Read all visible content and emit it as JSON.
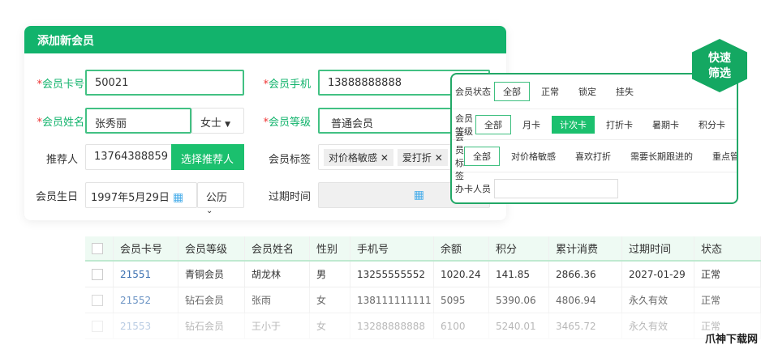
{
  "form": {
    "title": "添加新会员",
    "card_label": "会员卡号",
    "card_value": "50021",
    "phone_label": "会员手机",
    "phone_value": "13888888888",
    "name_label": "会员姓名",
    "name_value": "张秀丽",
    "gender_value": "女士",
    "level_label": "会员等级",
    "level_value": "普通会员",
    "referrer_label": "推荐人",
    "referrer_value": "13764388859",
    "referrer_button": "选择推荐人",
    "tags_label": "会员标签",
    "tags": [
      "对价格敏感",
      "爱打折"
    ],
    "birthday_label": "会员生日",
    "birthday_value": "1997年5月29日",
    "calendar_value": "公历",
    "expire_label": "过期时间"
  },
  "filter": {
    "badge_line1": "快速",
    "badge_line2": "筛选",
    "rows": [
      {
        "label": "会员状态",
        "options": [
          "全部",
          "正常",
          "锁定",
          "挂失"
        ]
      },
      {
        "label": "会员等级",
        "options": [
          "全部",
          "月卡",
          "计次卡",
          "打折卡",
          "暑期卡",
          "积分卡"
        ]
      },
      {
        "label": "会员标签",
        "options": [
          "全部",
          "对价格敏感",
          "喜欢打折",
          "需要长期跟进的",
          "重点管"
        ]
      }
    ],
    "staff_label": "办卡人员"
  },
  "table": {
    "headers": [
      "会员卡号",
      "会员等级",
      "会员姓名",
      "性别",
      "手机号",
      "余额",
      "积分",
      "累计消费",
      "过期时间",
      "状态"
    ],
    "rows": [
      [
        "21551",
        "青铜会员",
        "胡龙林",
        "男",
        "13255555552",
        "1020.24",
        "141.85",
        "2866.36",
        "2027-01-29",
        "正常"
      ],
      [
        "21552",
        "钻石会员",
        "张雨",
        "女",
        "138111111111",
        "5095",
        "5390.06",
        "4806.94",
        "永久有效",
        "正常"
      ],
      [
        "21553",
        "钻石会员",
        "王小于",
        "女",
        "13288888888",
        "6100",
        "5240.01",
        "3465.72",
        "永久有效",
        "正常"
      ]
    ]
  },
  "watermark": "爪神下载网"
}
